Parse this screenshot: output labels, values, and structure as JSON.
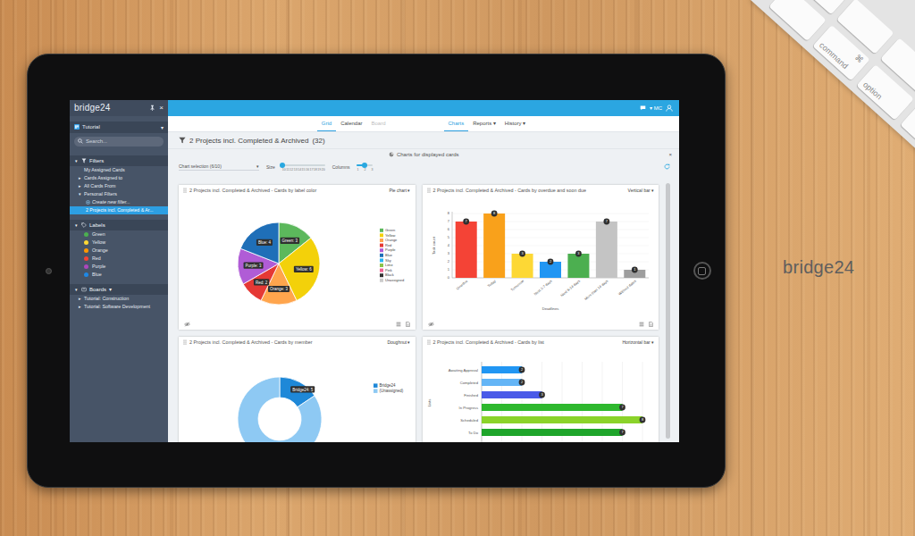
{
  "desk": {
    "logo": "bridge24",
    "keyboard": {
      "keys": [
        {
          "lines": [
            "⌘",
            "command"
          ]
        },
        {
          "lines": [
            "option"
          ]
        }
      ]
    }
  },
  "app": {
    "sidebar": {
      "logo": "bridge24",
      "close": "×",
      "workspace": {
        "label": "Tutorial",
        "caret": "▾"
      },
      "search": {
        "placeholder": "Search..."
      },
      "sections": [
        {
          "title": "Filters",
          "arrow": "▾",
          "items": [
            {
              "label": "My Assigned Cards",
              "kind": "plain",
              "selected": false
            },
            {
              "label": "Cards Assigned to",
              "arrow": "▸",
              "kind": "branch",
              "selected": false
            },
            {
              "label": "All Cards From",
              "arrow": "▸",
              "kind": "branch",
              "selected": false
            },
            {
              "label": "Personal Filters",
              "arrow": "▾",
              "kind": "branch",
              "selected": false
            },
            {
              "label": "Create new filter...",
              "kind": "action",
              "selected": false
            },
            {
              "label": "2 Projects incl. Completed & Ar...",
              "kind": "child",
              "selected": true
            }
          ]
        },
        {
          "title": "Labels",
          "arrow": "▾",
          "items": [
            {
              "label": "Green",
              "kind": "label",
              "color": "#4caf50",
              "selected": false
            },
            {
              "label": "Yellow",
              "kind": "label",
              "color": "#fdd835",
              "selected": false
            },
            {
              "label": "Orange",
              "kind": "label",
              "color": "#ff9800",
              "selected": false
            },
            {
              "label": "Red",
              "kind": "label",
              "color": "#f44336",
              "selected": false
            },
            {
              "label": "Purple",
              "kind": "label",
              "color": "#ab47bc",
              "selected": false
            },
            {
              "label": "Blue",
              "kind": "label",
              "color": "#1e88e5",
              "selected": false
            }
          ]
        },
        {
          "title": "Boards",
          "arrow": "▾",
          "caret": "▾",
          "items": [
            {
              "label": "Tutorial: Construction",
              "arrow": "▸",
              "kind": "branch",
              "selected": false
            },
            {
              "label": "Tutorial: Software Development",
              "arrow": "▸",
              "kind": "branch",
              "selected": false
            }
          ]
        }
      ]
    },
    "topbar": {
      "caret": "▾",
      "user": "MC"
    },
    "view_tabs": [
      {
        "label": "Grid",
        "selected": true,
        "disabled": false
      },
      {
        "label": "Calendar",
        "selected": false,
        "disabled": false
      },
      {
        "label": "Board",
        "selected": false,
        "disabled": true
      }
    ],
    "mode_tabs": [
      {
        "label": "Charts",
        "selected": true
      },
      {
        "label": "Reports ▾",
        "selected": false
      },
      {
        "label": "History ▾",
        "selected": false
      }
    ],
    "title": {
      "text": "2 Projects incl. Completed & Archived",
      "count": "(32)"
    },
    "charts_bar": {
      "label": "Charts for displayed cards",
      "close": "×"
    },
    "controls": {
      "chart_selection": "Chart selection (6/10)",
      "caret": "▾",
      "size": {
        "label": "Size",
        "level": 0,
        "ticks": [
          "10",
          "11",
          "12",
          "13",
          "14",
          "15",
          "16",
          "17",
          "18",
          "19",
          "20"
        ]
      },
      "columns": {
        "label": "Columns",
        "level": 0.5,
        "ticks": [
          "1",
          "2",
          "3"
        ]
      }
    },
    "charts": [
      {
        "kind": "pie",
        "title": "2 Projects incl. Completed & Archived - Cards by label color",
        "type": "Pie chart ▾",
        "slices": [
          {
            "name": "Green",
            "value": 3,
            "badge": "Green: 3",
            "color": "#5cb85c"
          },
          {
            "name": "Yellow",
            "value": 6,
            "badge": "Yellow: 6",
            "color": "#f3d10a"
          },
          {
            "name": "Orange",
            "value": 3,
            "badge": "Orange: 3",
            "color": "#ffa54d"
          },
          {
            "name": "Red",
            "value": 2,
            "badge": "Red: 2",
            "color": "#e53935"
          },
          {
            "name": "Purple",
            "value": 3,
            "badge": "Purple: 3",
            "color": "#b05cd6"
          },
          {
            "name": "Blue",
            "value": 4,
            "badge": "Blue: 4",
            "color": "#1f6fb8"
          }
        ],
        "legend": [
          {
            "label": "Green",
            "color": "#5cb85c"
          },
          {
            "label": "Yellow",
            "color": "#f3d10a"
          },
          {
            "label": "Orange",
            "color": "#ffa54d"
          },
          {
            "label": "Red",
            "color": "#e53935"
          },
          {
            "label": "Purple",
            "color": "#b05cd6"
          },
          {
            "label": "Blue",
            "color": "#1f6fb8"
          },
          {
            "label": "Sky",
            "color": "#29b6f6"
          },
          {
            "label": "Lime",
            "color": "#8bc34a"
          },
          {
            "label": "Pink",
            "color": "#f06292"
          },
          {
            "label": "Black",
            "color": "#333333"
          },
          {
            "label": "Unassigned",
            "color": "#cccccc"
          }
        ]
      },
      {
        "kind": "vbar",
        "title": "2 Projects incl. Completed & Archived - Cards by overdue and soon due",
        "type": "Vertical bar ▾",
        "y_label": "Task count",
        "x_label": "Deadlines",
        "y_ticks": [
          "0",
          "1",
          "2",
          "3",
          "4",
          "5",
          "6",
          "7",
          "8"
        ],
        "bars": [
          {
            "label": "Overdue",
            "value": 7,
            "badge": "7",
            "color": "#f44336"
          },
          {
            "label": "Today",
            "value": 8,
            "badge": "8",
            "color": "#f9a11b"
          },
          {
            "label": "Tomorrow",
            "value": 3,
            "badge": "3",
            "color": "#fdd835"
          },
          {
            "label": "Next 2-7 days",
            "value": 2,
            "badge": "2",
            "color": "#2196f3"
          },
          {
            "label": "Next 8-14 days",
            "value": 3,
            "badge": "3",
            "color": "#4caf50"
          },
          {
            "label": "More than 14 days",
            "value": 7,
            "badge": "7",
            "color": "#c4c4c4"
          },
          {
            "label": "Without dates",
            "value": 1,
            "badge": "1",
            "color": "#9e9e9e"
          }
        ]
      },
      {
        "kind": "doughnut",
        "title": "2 Projects incl. Completed & Archived - Cards by member",
        "type": "Doughnut ▾",
        "segments": [
          {
            "name": "Bridge24",
            "value": 5,
            "badge": "Bridge24: 5",
            "color": "#1e88d8"
          },
          {
            "name": "(Unassigned)",
            "value": 27,
            "color": "#8ec9f3"
          }
        ],
        "legend": [
          {
            "label": "Bridge24",
            "color": "#1e88d8"
          },
          {
            "label": "(Unassigned)",
            "color": "#8ec9f3"
          }
        ]
      },
      {
        "kind": "hbar",
        "title": "2 Projects incl. Completed & Archived - Cards by list",
        "type": "Horizontal bar ▾",
        "y_label": "Lists",
        "bars": [
          {
            "label": "Awaiting Approval",
            "value": 2,
            "badge": "2",
            "color": "#2196f3"
          },
          {
            "label": "Completed",
            "value": 2,
            "badge": "2",
            "color": "#64b5f6"
          },
          {
            "label": "Finished",
            "value": 3,
            "badge": "3",
            "color": "#4a5ae8"
          },
          {
            "label": "In Progress",
            "value": 7,
            "badge": "7",
            "color": "#2eb82e"
          },
          {
            "label": "Scheduled",
            "value": 8,
            "badge": "8",
            "color": "#8bd32a"
          },
          {
            "label": "To Do",
            "value": 7,
            "badge": "7",
            "color": "#1fa52b"
          }
        ]
      }
    ]
  }
}
